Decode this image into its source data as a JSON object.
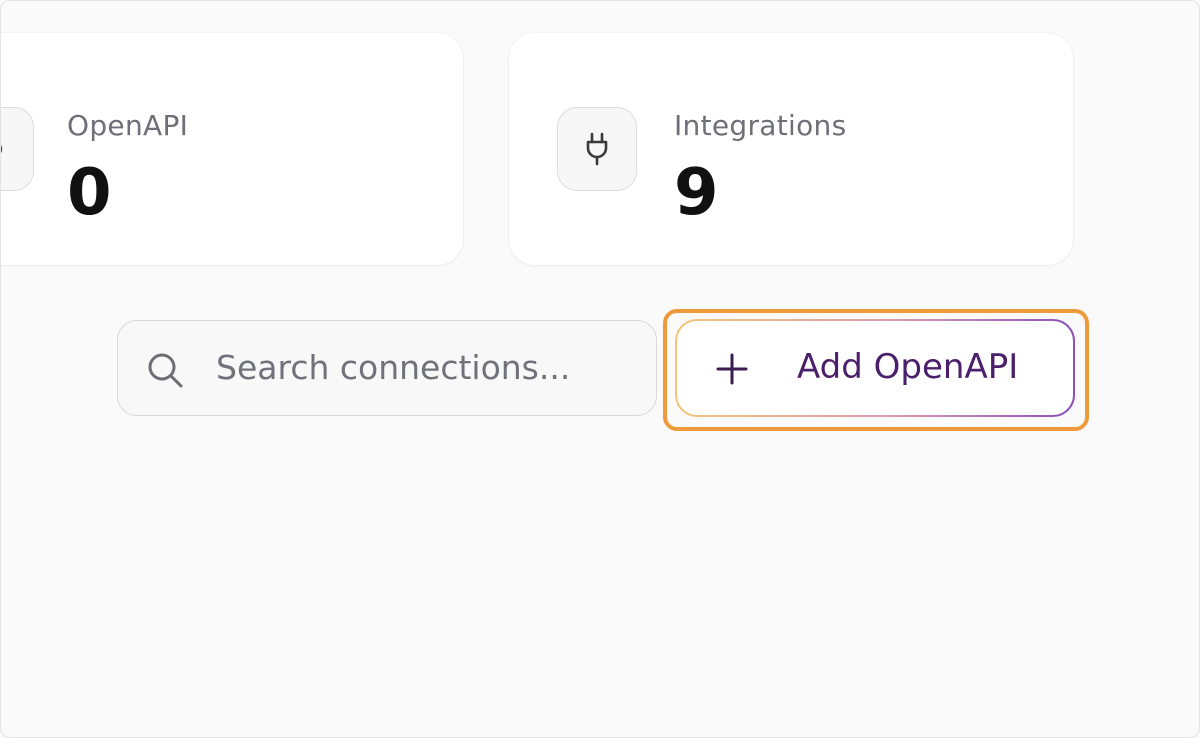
{
  "stats": [
    {
      "label": "OpenAPI",
      "value": "0",
      "icon": "openapi-icon"
    },
    {
      "label": "Integrations",
      "value": "9",
      "icon": "plug-icon"
    }
  ],
  "search": {
    "placeholder": "Search connections...",
    "value": "",
    "icon": "search-icon"
  },
  "add_button": {
    "label": "Add OpenAPI",
    "icon": "plus-icon"
  },
  "colors": {
    "background": "#fafafa",
    "card": "#ffffff",
    "highlight": "#ee9a3a",
    "button_text": "#4b1f6b",
    "gradient_start": "#f3c778",
    "gradient_end": "#8a4fb7"
  }
}
